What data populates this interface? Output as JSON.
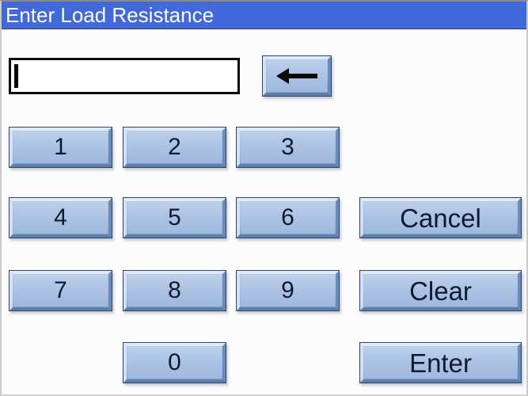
{
  "window": {
    "title": "Enter Load Resistance",
    "title_bar_color": "#4269dc",
    "title_text_color": "#ffffff",
    "background_color": "#fcfcfc"
  },
  "input": {
    "value": "",
    "placeholder": "",
    "caret_visible": true
  },
  "keypad": {
    "backspace": {
      "icon": "left-arrow-icon",
      "label": "←"
    },
    "digits": [
      {
        "label": "1"
      },
      {
        "label": "2"
      },
      {
        "label": "3"
      },
      {
        "label": "4"
      },
      {
        "label": "5"
      },
      {
        "label": "6"
      },
      {
        "label": "7"
      },
      {
        "label": "8"
      },
      {
        "label": "9"
      },
      {
        "label": "0"
      }
    ],
    "actions": [
      {
        "label": "Cancel"
      },
      {
        "label": "Clear"
      },
      {
        "label": "Enter"
      }
    ],
    "key_face_color": "#a8c0e2",
    "key_border_color": "#2b4573",
    "key_text_color": "#101a2e"
  }
}
